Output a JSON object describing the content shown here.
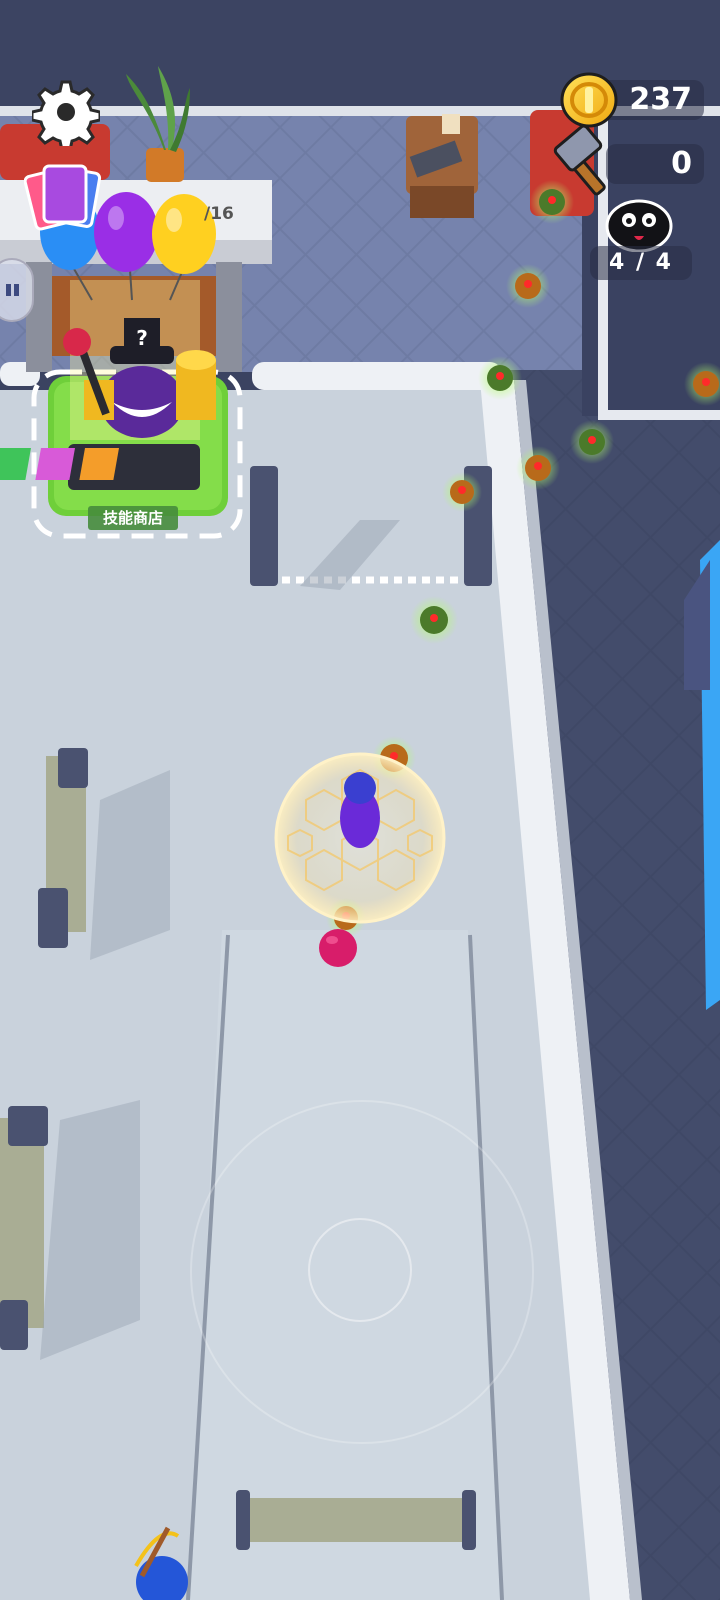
{
  "hud": {
    "coins": "237",
    "hammers": "0",
    "enemies": "4 / 4"
  },
  "shop": {
    "label": "技能商店",
    "floor_number": "/16"
  },
  "icons": {
    "settings": "gear-icon",
    "coin": "gold-coin-icon",
    "hammer": "hammer-icon",
    "enemy": "black-blob-enemy-icon",
    "cards": "skill-cards-icon"
  },
  "colors": {
    "floor": "#c9d2dc",
    "outer_floor": "#3b4361",
    "wall": "#e9edf3",
    "shop_mat": "#6fcf3a",
    "coin": "#f7c31a",
    "player": "#3a3fd0",
    "mine_glow": "#8cd84a"
  }
}
